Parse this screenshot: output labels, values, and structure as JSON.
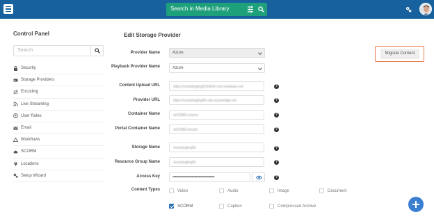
{
  "header": {
    "search_placeholder": "Search in Media Library",
    "menu_icon": "hamburger-icon",
    "filter_icon": "filter-icon",
    "search_icon": "search-icon",
    "settings_icon": "gear-icon",
    "bar_color": "#17629e",
    "search_color": "#1ea07a"
  },
  "sidebar": {
    "title": "Control Panel",
    "search_placeholder": "Search",
    "items": [
      {
        "label": "Security",
        "icon": "lock-icon"
      },
      {
        "label": "Storage Providers",
        "icon": "storage-icon"
      },
      {
        "label": "Encoding",
        "icon": "swap-icon"
      },
      {
        "label": "Live Streaming",
        "icon": "rss-icon"
      },
      {
        "label": "User Roles",
        "icon": "user-roles-icon"
      },
      {
        "label": "Email",
        "icon": "envelope-icon"
      },
      {
        "label": "Workflows",
        "icon": "workflow-icon"
      },
      {
        "label": "SCORM",
        "icon": "cloud-icon"
      },
      {
        "label": "Locations",
        "icon": "map-marker-icon"
      },
      {
        "label": "Setup Wizard",
        "icon": "cogs-icon"
      }
    ]
  },
  "main": {
    "title": "Edit Storage Provider",
    "migrate_label": "Migrate Content",
    "fields": {
      "provider_name": {
        "label": "Provider Name",
        "value": "Azure"
      },
      "playback_provider_name": {
        "label": "Playback Provider Name",
        "value": "Azure"
      },
      "content_upload_url": {
        "label": "Content Upload URL",
        "value": "https://vrsamingtng5r3n6h4.core.windows.net"
      },
      "provider_url": {
        "label": "Provider URL",
        "value": "https://vrsamingtng5h-cdn.azureedge.net"
      },
      "container_name": {
        "label": "Container Name",
        "value": "vtr52883-source"
      },
      "portal_container_name": {
        "label": "Portal Container Name",
        "value": "vtr52883-tenant"
      },
      "storage_name": {
        "label": "Storage Name",
        "value": "vrsamingtng5h"
      },
      "resource_group_name": {
        "label": "Resource Group Name",
        "value": "vrsamingtng5h"
      },
      "access_key": {
        "label": "Access Key",
        "value": "••••••••••••••••••••••••••••••••••••••••••••••••"
      }
    },
    "content_types": {
      "label": "Content Types",
      "options": [
        {
          "label": "Video",
          "checked": false
        },
        {
          "label": "Audio",
          "checked": false
        },
        {
          "label": "Image",
          "checked": false
        },
        {
          "label": "Document",
          "checked": false
        },
        {
          "label": "SCORM",
          "checked": true
        },
        {
          "label": "Caption",
          "checked": false
        },
        {
          "label": "Compressed Archive",
          "checked": false
        }
      ]
    },
    "highlight_color": "#e87d54",
    "fab_color": "#3a7fd0"
  }
}
